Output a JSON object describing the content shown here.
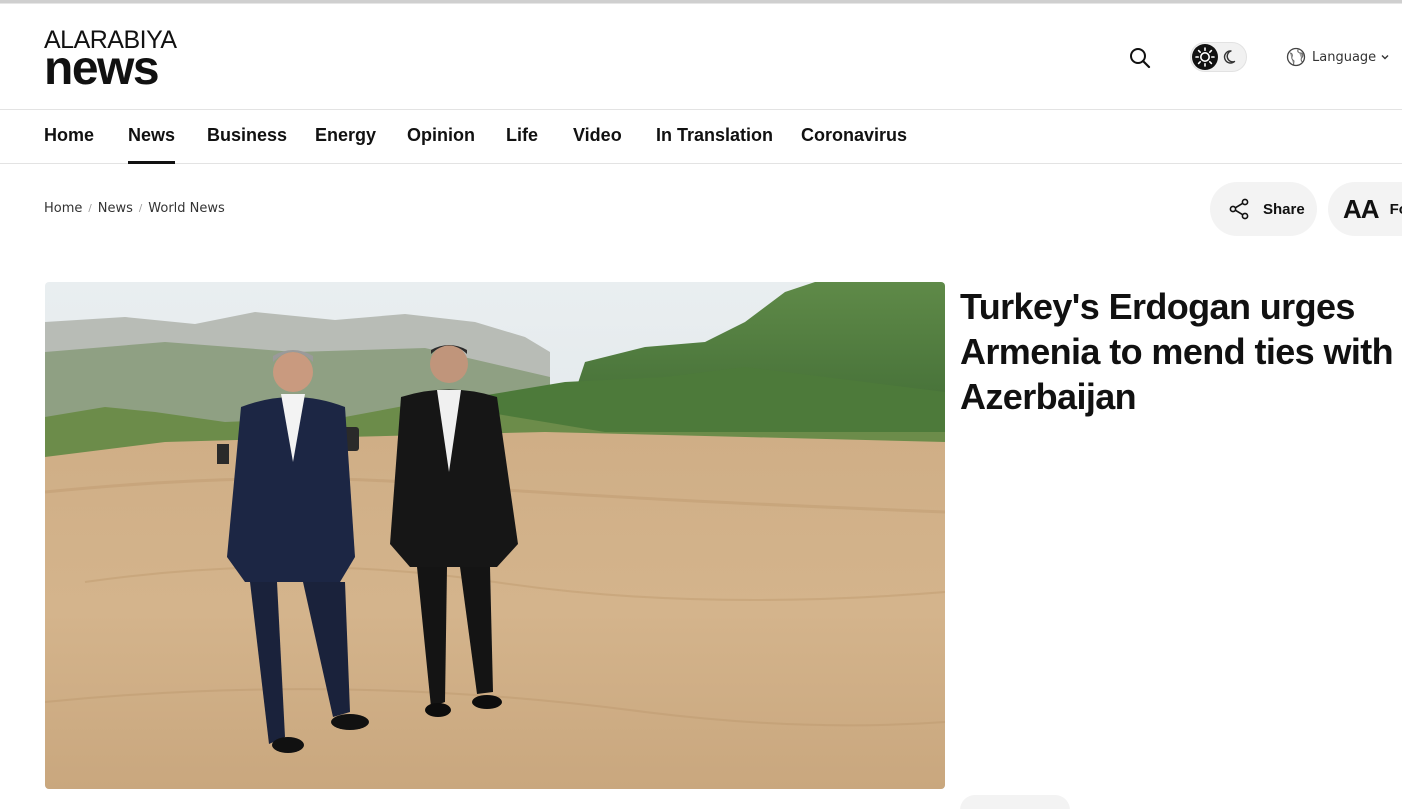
{
  "site": {
    "logo_top": "ALARABIYA",
    "logo_bottom": "news"
  },
  "header": {
    "language_label": "Language",
    "icons": [
      "search-icon",
      "sun-icon",
      "moon-icon",
      "globe-icon",
      "chevron-down-icon"
    ]
  },
  "nav": {
    "items": [
      {
        "label": "Home"
      },
      {
        "label": "News",
        "active": true
      },
      {
        "label": "Business"
      },
      {
        "label": "Energy"
      },
      {
        "label": "Opinion"
      },
      {
        "label": "Life"
      },
      {
        "label": "Video"
      },
      {
        "label": "In Translation"
      },
      {
        "label": "Coronavirus"
      }
    ]
  },
  "breadcrumb": {
    "items": [
      "Home",
      "News",
      "World News"
    ],
    "separator": "/"
  },
  "toolbar": {
    "share_label": "Share",
    "font_icon_text": "AA",
    "font_label": "Font"
  },
  "article": {
    "headline": "Turkey's Erdogan urges Armenia to mend ties with Azerbaijan"
  },
  "colors": {
    "text": "#111111",
    "pill_bg": "#f3f3f3",
    "divider": "#e3e3e3"
  }
}
